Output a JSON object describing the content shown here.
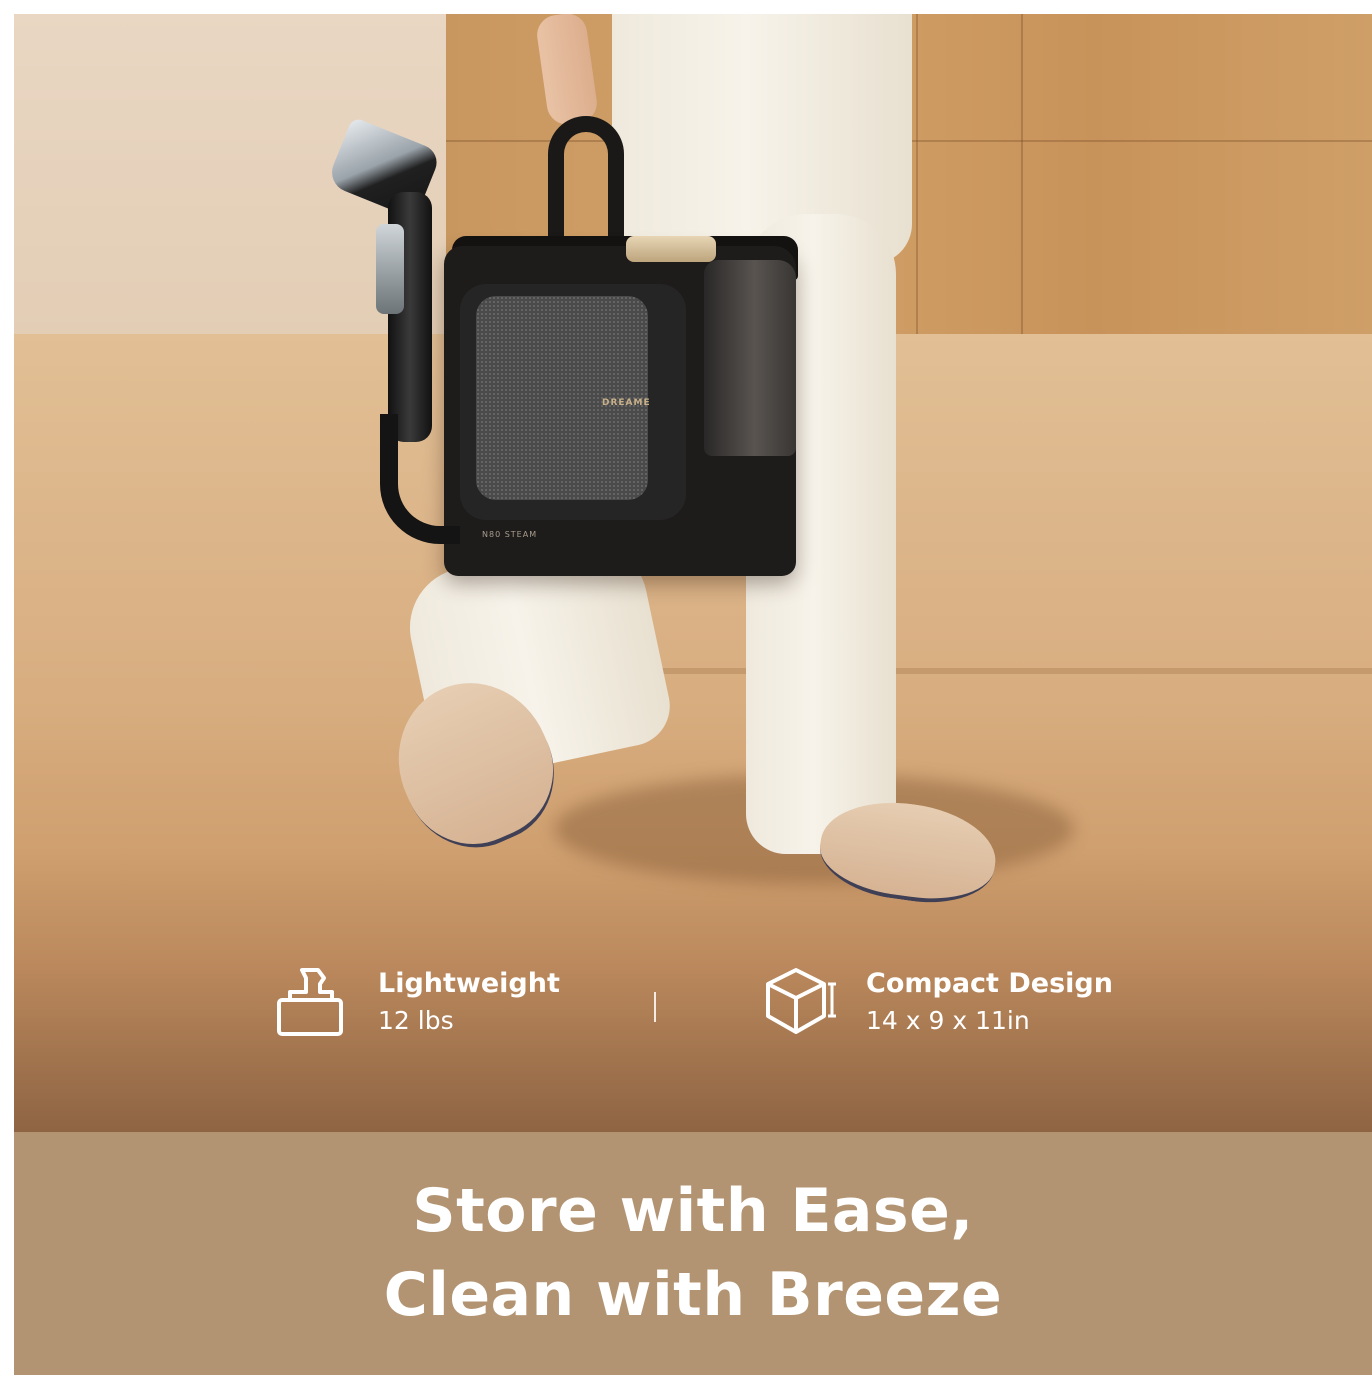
{
  "product": {
    "brand_mark": "DREAME",
    "model_mark": "N80 STEAM"
  },
  "features": [
    {
      "icon": "bag-lift-icon",
      "title": "Lightweight",
      "value": "12 lbs"
    },
    {
      "icon": "cube-dimensions-icon",
      "title": "Compact Design",
      "value": "14 x 9 x 11in"
    }
  ],
  "headline": {
    "line1": "Store with Ease,",
    "line2": "Clean with Breeze"
  },
  "colors": {
    "banner": "#b39472",
    "device": "#1e1c1b",
    "text": "#ffffff"
  }
}
